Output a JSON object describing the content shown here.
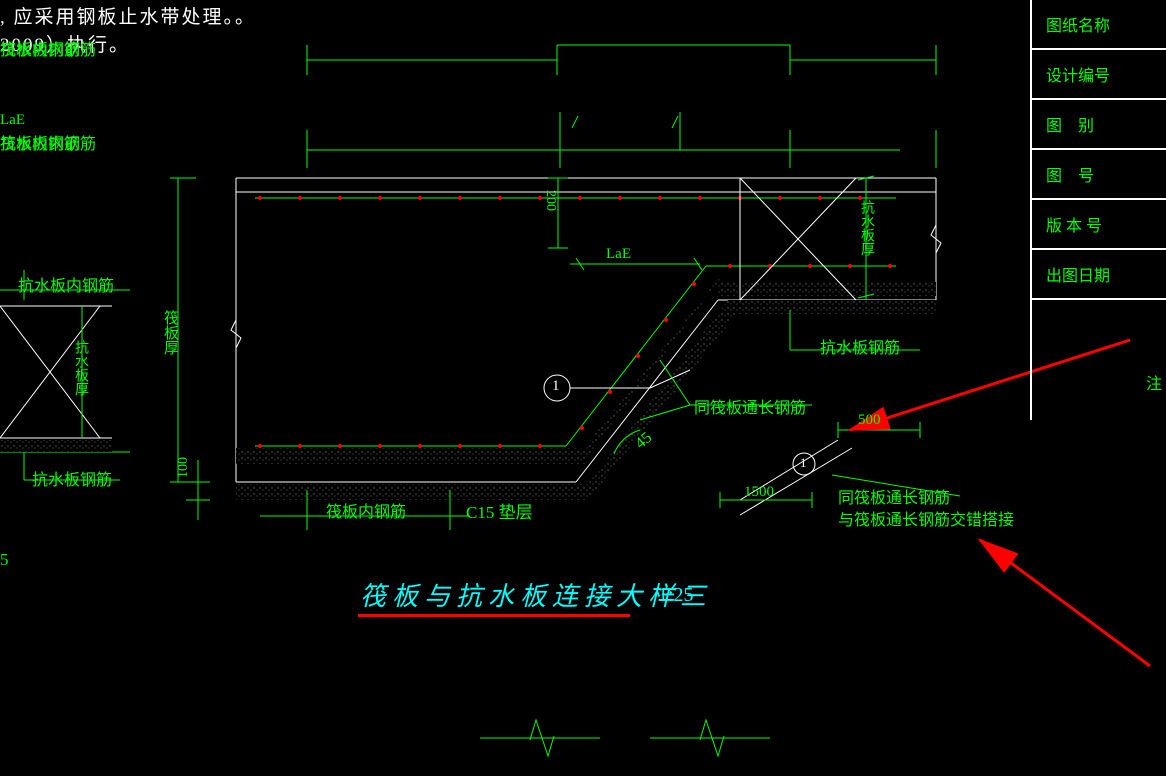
{
  "top_notes": {
    "line1": ", 应采用钢板止水带处理。。",
    "line2": "2009）执行。"
  },
  "labels": {
    "raft_inner_rebar": "筏板内钢筋",
    "water_inner_rebar": "抗水板内钢筋",
    "water_rebar": "抗水板钢筋",
    "same_raft_through_rebar": "同筏板通长钢筋",
    "same_raft_overlap": "与筏板通长钢筋交错搭接",
    "c15_bedding": "C15 垫层",
    "angle45": "45",
    "raft_thickness_v": "筏板厚",
    "water_thickness_v": "抗水板厚",
    "dim200": "200",
    "dim100": "100",
    "dim500": "500",
    "dim1500": "1500",
    "dim_LaE": "LaE",
    "circle1": "1"
  },
  "title": {
    "main": "筏板与抗水板连接大样三",
    "scale": "1:25"
  },
  "right_panel": {
    "r1": "图纸名称",
    "r2": "设计编号",
    "r3": "图　别",
    "r4": "图　号",
    "r5": "版 本 号",
    "r6": "出图日期",
    "r7": "注"
  },
  "left_frag": {
    "dim_unknown": "5"
  }
}
